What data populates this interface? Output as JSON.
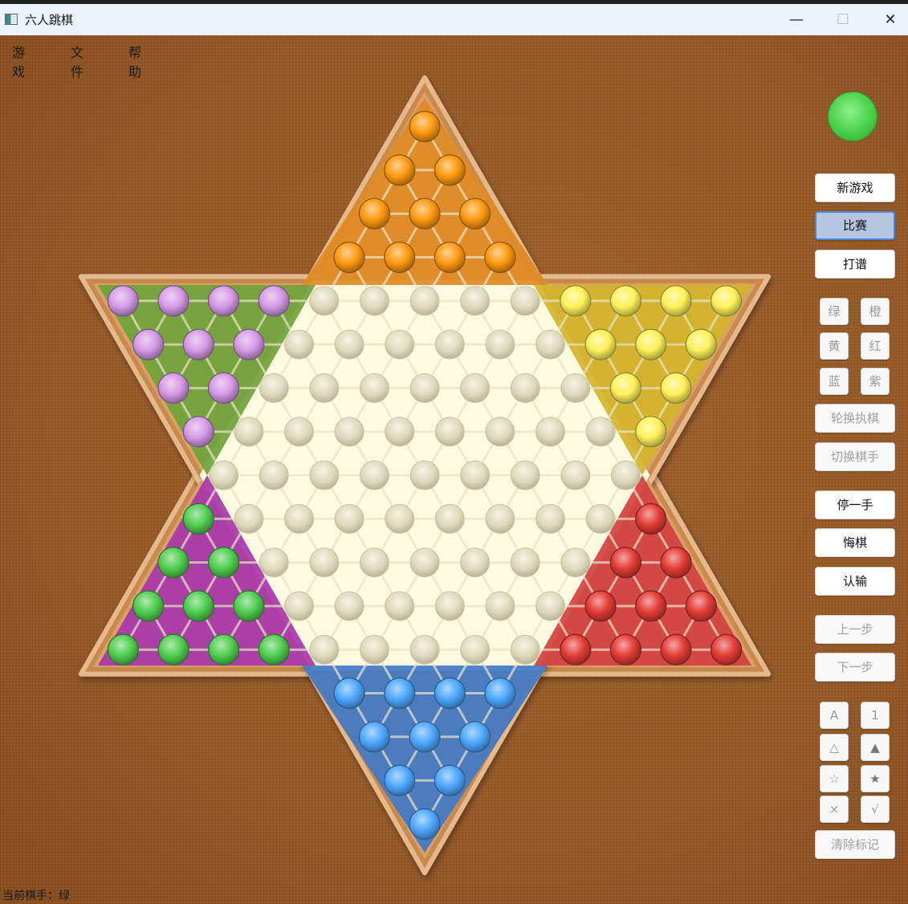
{
  "window": {
    "title": "六人跳棋",
    "minimize": "—",
    "maximize": "☐",
    "close": "✕"
  },
  "menu": [
    "游戏",
    "文件",
    "帮助"
  ],
  "board": {
    "empty_hole_color": "#ddd9bc",
    "players": [
      {
        "name": "orange",
        "color": "#ff9a10",
        "zone_color": "#e08a25"
      },
      {
        "name": "green",
        "color": "#4fcf4f",
        "zone_color": "#6ea33a"
      },
      {
        "name": "yellow",
        "color": "#fff25a",
        "zone_color": "#d4b42a"
      },
      {
        "name": "purple",
        "color": "#d69ae6",
        "zone_color": "#a836ab"
      },
      {
        "name": "red",
        "color": "#e43c36",
        "zone_color": "#d24040"
      },
      {
        "name": "blue",
        "color": "#4ea8ff",
        "zone_color": "#4178c6"
      }
    ]
  },
  "current_player_color": "#4fcf4f",
  "buttons": {
    "new_game": "新游戏",
    "match": "比赛",
    "record": "打谱",
    "colors": [
      "绿",
      "橙",
      "黄",
      "红",
      "蓝",
      "紫"
    ],
    "rotate": "轮换执棋",
    "switch_player": "切换棋手",
    "pass": "停一手",
    "undo": "悔棋",
    "resign": "认输",
    "prev": "上一步",
    "next": "下一步",
    "marks": [
      "A",
      "1",
      "△",
      "▲",
      "☆",
      "★",
      "×",
      "√"
    ],
    "clear_marks": "清除标记"
  },
  "status": {
    "text": "当前棋手：绿"
  }
}
